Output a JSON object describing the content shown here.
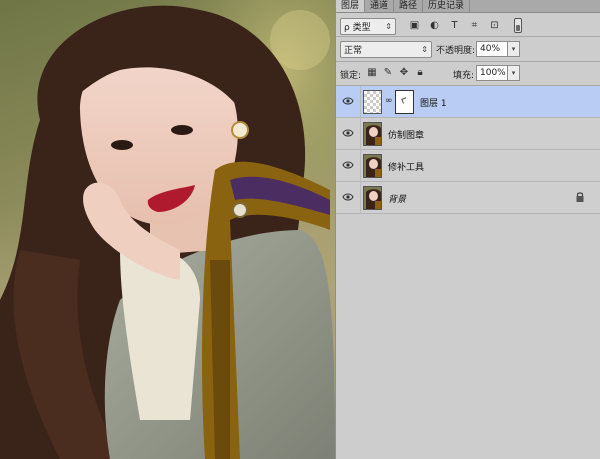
{
  "tabs": [
    "图层",
    "通道",
    "路径",
    "历史记录"
  ],
  "filter": {
    "kind_label": "ρ 类型",
    "icons": [
      "image-filter-icon",
      "adjustment-filter-icon",
      "type-filter-icon",
      "shape-filter-icon",
      "smart-object-filter-icon"
    ]
  },
  "blend": {
    "mode": "正常",
    "opacity_label": "不透明度:",
    "opacity_value": "40%"
  },
  "lock": {
    "label": "锁定:",
    "fill_label": "填充:",
    "fill_value": "100%"
  },
  "layers": [
    {
      "name": "图层 1",
      "selected": true
    },
    {
      "name": "仿制图章",
      "selected": false
    },
    {
      "name": "修补工具",
      "selected": false
    },
    {
      "name": "背景",
      "selected": false,
      "locked": true
    }
  ],
  "colors": {
    "selected_row": "#b9cdf4",
    "panel_bg": "#cdcdcd",
    "lip": "#b01a2e"
  }
}
